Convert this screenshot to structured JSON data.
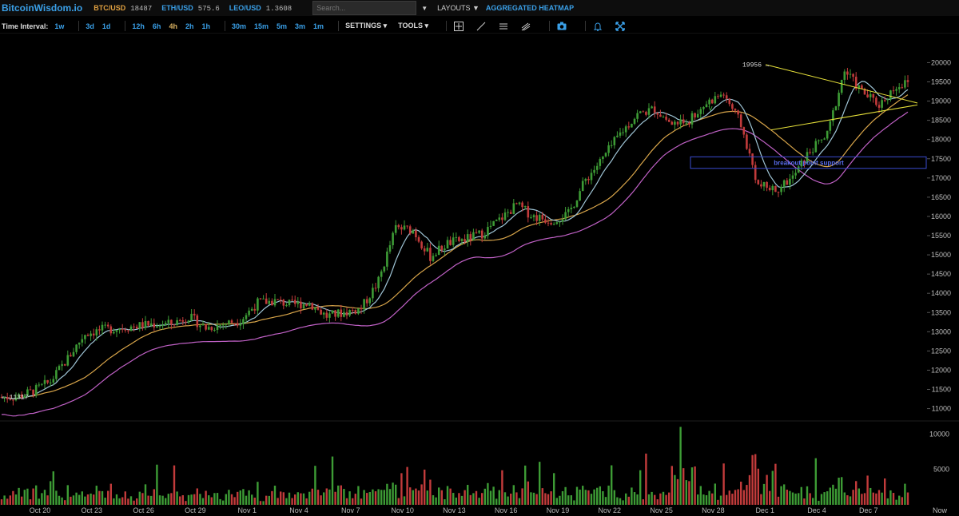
{
  "app": {
    "title": "BitcoinWisdom.io"
  },
  "tickers": [
    {
      "pair": "BTC/USD",
      "price": "18487",
      "color": "#e0a040"
    },
    {
      "pair": "ETH/USD",
      "price": "575.6",
      "color": "#3aa0e8"
    },
    {
      "pair": "LEO/USD",
      "price": "1.3608",
      "color": "#3aa0e8"
    }
  ],
  "search": {
    "placeholder": "Search..."
  },
  "menus": {
    "layouts": "LAYOUTS",
    "heatmap": "AGGREGATED HEATMAP"
  },
  "toolbar": {
    "label": "Time Interval:",
    "intervals": [
      "1w",
      "3d",
      "1d",
      "12h",
      "6h",
      "4h",
      "2h",
      "1h",
      "30m",
      "15m",
      "5m",
      "3m",
      "1m"
    ],
    "active_interval": "4h",
    "settings": "SETTINGS",
    "tools": "TOOLS",
    "tool_icons": [
      "crosshair-icon",
      "trendline-icon",
      "parallel-channel-icon",
      "fib-tool-icon",
      "camera-icon",
      "bell-icon",
      "fullscreen-icon"
    ]
  },
  "colors": {
    "bg": "#000000",
    "up": "#3d9b35",
    "down": "#c23b3b",
    "ma_short": "#9fc5d6",
    "ma_mid": "#d8a54a",
    "ma_long": "#c061c6",
    "triangle": "#e8e23a",
    "box": "#3a4bd0",
    "accent": "#3aa0e8"
  },
  "chart_data": {
    "type": "candlestick",
    "symbol": "BTC/USD",
    "interval": "4h",
    "x_labels": [
      "Oct 20",
      "Oct 23",
      "Oct 26",
      "Oct 29",
      "Nov 1",
      "Nov 4",
      "Nov 7",
      "Nov 10",
      "Nov 13",
      "Nov 16",
      "Nov 19",
      "Nov 22",
      "Nov 25",
      "Nov 28",
      "Dec 1",
      "Dec 4",
      "Dec 7",
      "Now"
    ],
    "y_ticks": [
      11000,
      11500,
      12000,
      12500,
      13000,
      13500,
      14000,
      14500,
      15000,
      15500,
      16000,
      16500,
      17000,
      17500,
      18000,
      18500,
      19000,
      19500,
      20000
    ],
    "ylim": [
      10700,
      20300
    ],
    "volume_ticks": [
      5000,
      10000
    ],
    "volume_ylim": [
      0,
      11500
    ],
    "close_path_x_day": [
      0,
      1,
      2,
      3,
      4,
      5,
      6,
      7,
      8,
      9,
      10,
      11,
      12,
      13,
      14,
      15,
      16,
      17,
      18,
      19,
      20,
      21,
      22,
      23,
      24,
      25,
      26,
      27,
      28,
      29,
      30,
      31,
      32,
      33,
      34,
      35,
      36,
      37,
      38,
      39,
      40,
      41,
      42,
      43,
      44,
      45,
      46,
      47,
      48,
      49,
      50,
      51
    ],
    "close_path_y": [
      11300,
      11450,
      11700,
      12300,
      12950,
      13050,
      13100,
      13150,
      13200,
      13200,
      13400,
      13100,
      13200,
      13300,
      13750,
      13800,
      13700,
      13750,
      13400,
      13500,
      13600,
      14300,
      15700,
      15650,
      14950,
      15300,
      15400,
      15550,
      15900,
      16300,
      16000,
      15900,
      16050,
      16950,
      17500,
      18150,
      18650,
      18800,
      18400,
      18500,
      18950,
      19200,
      18400,
      16800,
      16700,
      17000,
      17700,
      18100,
      19800,
      19250,
      18900,
      19400
    ],
    "close_path_y_tail": [
      19500,
      19100,
      19200,
      19300,
      19000,
      18200,
      18487
    ],
    "annotations": [
      {
        "text": "19956",
        "type": "price-marker",
        "value": 19956
      },
      {
        "text": "11317",
        "type": "price-marker",
        "value": 11317
      },
      {
        "text": "breakout point support",
        "type": "box-label"
      },
      {
        "text": "v",
        "type": "text"
      }
    ],
    "indicators": [
      "MA short",
      "MA mid",
      "MA long"
    ]
  }
}
